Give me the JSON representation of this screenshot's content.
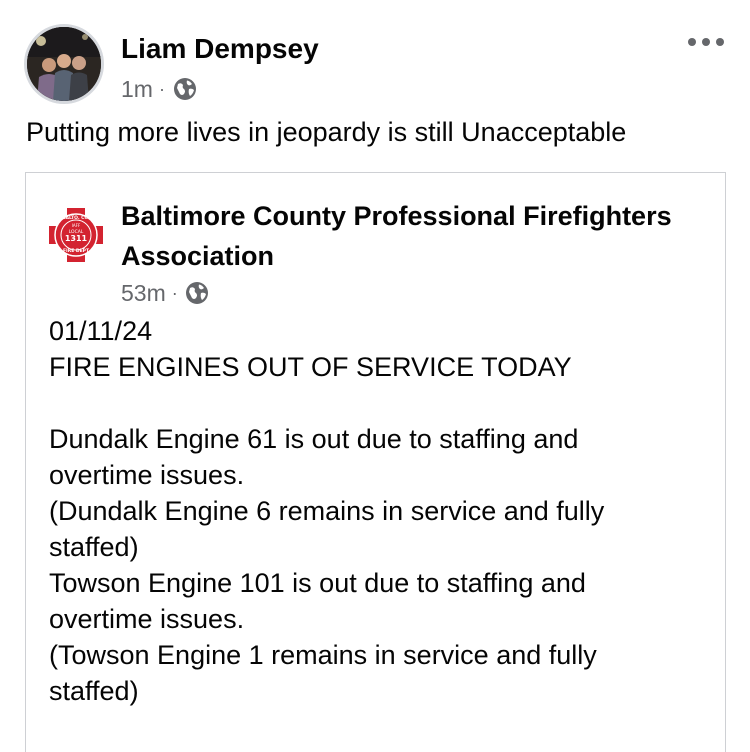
{
  "post": {
    "author": "Liam Dempsey",
    "time": "1m",
    "separator": "·",
    "text": "Putting more lives in jeopardy is still Unacceptable",
    "audience_icon": "globe-icon",
    "more_icon": "more-options-icon"
  },
  "shared": {
    "page_name": "Baltimore County Professional Firefighters Association",
    "time": "53m",
    "separator": "·",
    "logo_text": {
      "top": "BALTO. CO.",
      "local": "LOCAL",
      "number": "1311",
      "bottom": "FIRE DEPT",
      "iaff": "IAFF"
    },
    "body_lines": [
      "01/11/24",
      "FIRE ENGINES OUT OF SERVICE TODAY",
      "",
      "Dundalk Engine 61 is out due to staffing and",
      "overtime issues.",
      "(Dundalk Engine 6 remains in service and fully",
      "staffed)",
      "Towson Engine 101 is out due to staffing and",
      "overtime issues.",
      "(Towson Engine 1 remains in service and fully",
      "staffed)"
    ]
  },
  "colors": {
    "text": "#050505",
    "secondary": "#65676b",
    "border": "#ced0d4",
    "logo_red": "#d32330"
  }
}
